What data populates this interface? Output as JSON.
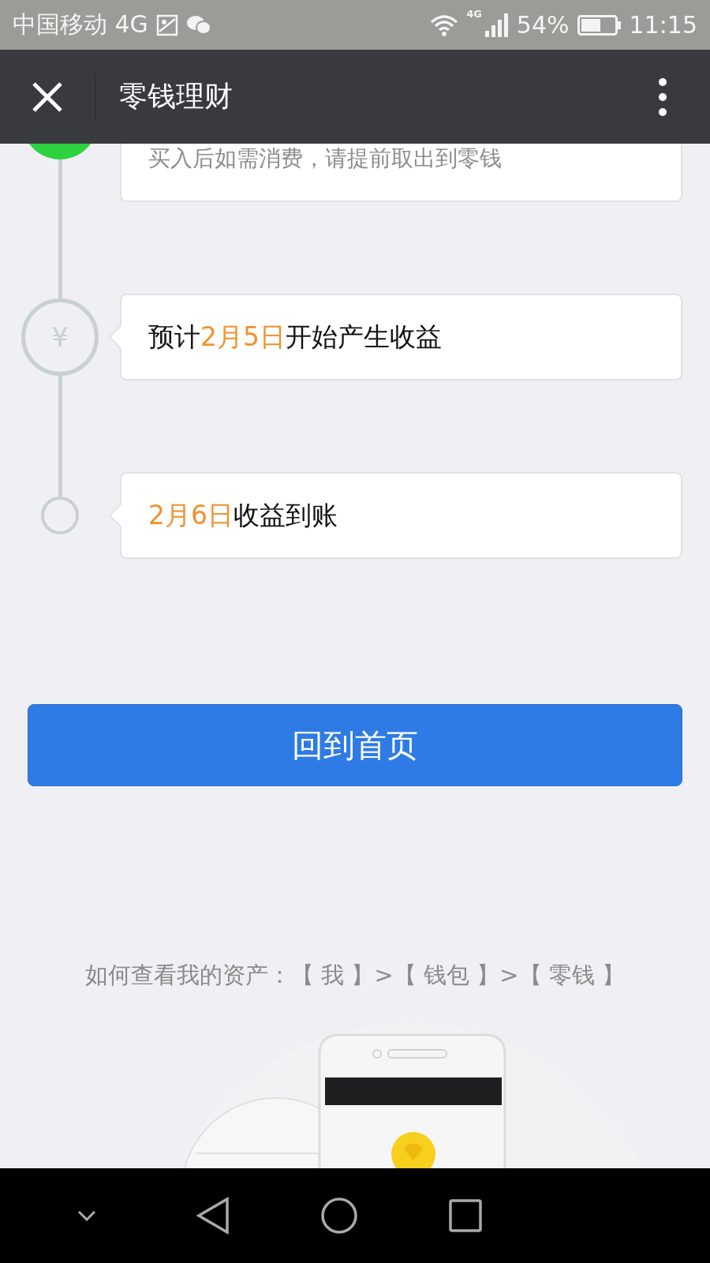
{
  "status_bar": {
    "carrier": "中国移动 4G",
    "network": "4G",
    "battery": "54%",
    "time": "11:15"
  },
  "nav_bar": {
    "title": "零钱理财"
  },
  "timeline": [
    {
      "kind": "done",
      "segments": [
        {
          "text": "买入后如需消费，请提前取出到零钱",
          "highlight": false
        }
      ]
    },
    {
      "kind": "yuan",
      "symbol": "¥",
      "segments": [
        {
          "text": "预计",
          "highlight": false
        },
        {
          "text": "2月5日",
          "highlight": true
        },
        {
          "text": "开始产生收益",
          "highlight": false
        }
      ]
    },
    {
      "kind": "pending",
      "segments": [
        {
          "text": "2月6日",
          "highlight": true
        },
        {
          "text": "收益到账",
          "highlight": false
        }
      ]
    }
  ],
  "primary_button": "回到首页",
  "help_text": "如何查看我的资产：【 我 】>【 钱包 】>【 零钱 】"
}
